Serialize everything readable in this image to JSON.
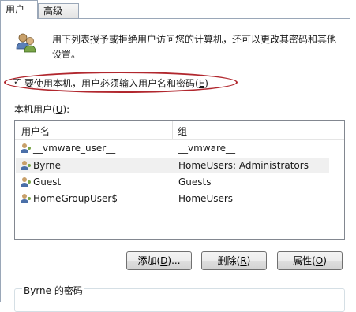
{
  "tabs": [
    {
      "label": "用户"
    },
    {
      "label": "高级"
    }
  ],
  "description": "用下列表授予或拒绝用户访问您的计算机，还可以更改其密码和其他设置。",
  "require_login": {
    "label_pre": "要使用本机，用户必须输入用户名和密码(",
    "label_key": "E",
    "label_post": ")",
    "checked": true
  },
  "local_users": {
    "label_pre": "本机用户(",
    "label_key": "U",
    "label_post": "):"
  },
  "table": {
    "columns": [
      "用户名",
      "组"
    ],
    "rows": [
      {
        "name": "__vmware_user__",
        "group": "__vmware__",
        "selected": false
      },
      {
        "name": "Byrne",
        "group": "HomeUsers; Administrators",
        "selected": true
      },
      {
        "name": "Guest",
        "group": "Guests",
        "selected": false
      },
      {
        "name": "HomeGroupUser$",
        "group": "HomeUsers",
        "selected": false
      }
    ]
  },
  "buttons": {
    "add": {
      "pre": "添加(",
      "key": "D",
      "post": ")..."
    },
    "remove": {
      "pre": "删除(",
      "key": "R",
      "post": ")"
    },
    "properties": {
      "pre": "属性(",
      "key": "O",
      "post": ")"
    }
  },
  "password_group": {
    "title": "Byrne 的密码"
  }
}
